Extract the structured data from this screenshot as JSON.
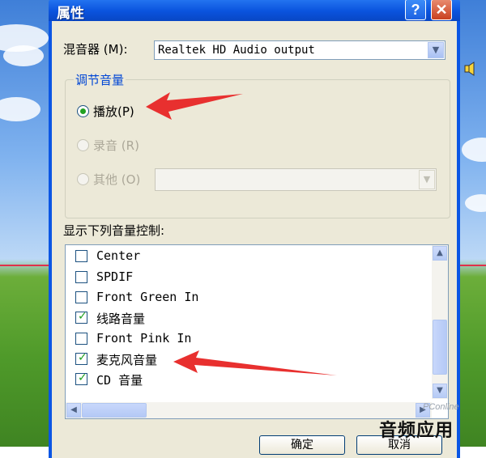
{
  "window": {
    "title": "属性",
    "help_label": "?",
    "close_label": "✕"
  },
  "mixer": {
    "label": "混音器",
    "mnemonic": "(M):",
    "value": "Realtek HD Audio output"
  },
  "volume_group": {
    "title": "调节音量",
    "options": [
      {
        "label": "播放",
        "mnemonic": "(P)",
        "selected": true,
        "enabled": true
      },
      {
        "label": "录音",
        "mnemonic": "(R)",
        "selected": false,
        "enabled": false
      },
      {
        "label": "其他",
        "mnemonic": "(O)",
        "selected": false,
        "enabled": false
      }
    ]
  },
  "controls": {
    "label": "显示下列音量控制:",
    "items": [
      {
        "label": "Center",
        "checked": false
      },
      {
        "label": "SPDIF",
        "checked": false
      },
      {
        "label": "Front Green In",
        "checked": false
      },
      {
        "label": "线路音量",
        "checked": true
      },
      {
        "label": "Front Pink In",
        "checked": false
      },
      {
        "label": "麦克风音量",
        "checked": true
      },
      {
        "label": "CD 音量",
        "checked": true
      }
    ]
  },
  "buttons": {
    "ok": "确定",
    "cancel": "取消"
  },
  "overlay": {
    "watermark": "音频应用",
    "site_mark": "PConline"
  },
  "colors": {
    "title_bar": "#0a53dd",
    "dialog_bg": "#ece9d8",
    "group_title": "#0046d5",
    "check": "#21a121",
    "annotation_arrow": "#e8302f"
  }
}
